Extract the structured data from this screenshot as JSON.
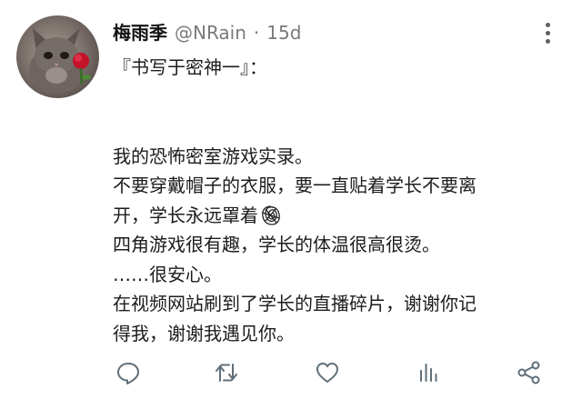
{
  "tweet": {
    "author_name": "梅雨季",
    "author_handle": "@NRain",
    "separator": "·",
    "timestamp": "15d",
    "lines": [
      "『书写于密神一』：",
      "",
      "",
      "我的恐怖密室游戏实录。",
      "不要穿戴帽子的衣服，要一直贴着学长不要离",
      "开，学长永远罩着",
      "四角游戏很有趣，学长的体温很高很烫。",
      "……很安心。",
      "在视频网站刷到了学长的直播碎片，谢谢你记",
      "得我，谢谢我遇见你。"
    ]
  },
  "icons": {
    "more": "more-vertical-icon",
    "reply": "reply-icon",
    "retweet": "retweet-icon",
    "like": "heart-icon",
    "analytics": "analytics-icon",
    "share": "share-icon"
  },
  "colors": {
    "text": "#1c1c1c",
    "secondary": "#7a7a7a",
    "action_icon": "#5f6f7a"
  }
}
